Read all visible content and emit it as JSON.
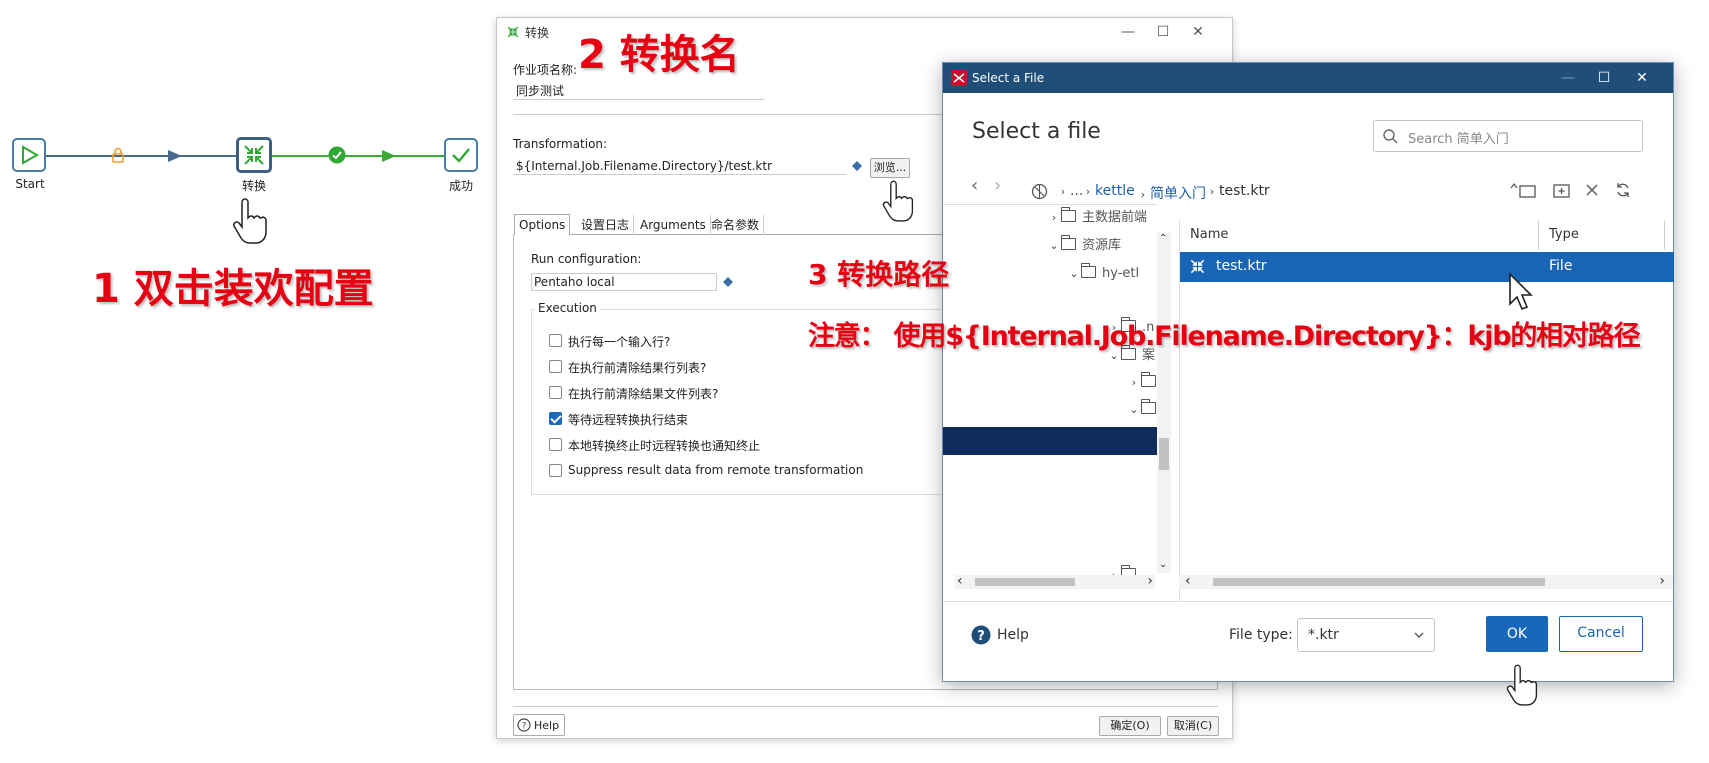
{
  "workflow": {
    "nodes": [
      {
        "label": "Start"
      },
      {
        "label": "转换"
      },
      {
        "label": "成功"
      }
    ]
  },
  "annotations": {
    "step1": "1 双击装欢配置",
    "step2": "2 转换名",
    "step3": "3 转换路径",
    "note": "注意： 使用${Internal.Job.Filename.Directory}：kjb的相对路径"
  },
  "trans_dialog": {
    "title": "转换",
    "job_entry_name_label": "作业项名称:",
    "job_entry_name_value": "同步测试",
    "transformation_label": "Transformation:",
    "transformation_value": "${Internal.Job.Filename.Directory}/test.ktr",
    "browse_label": "浏览...",
    "tabs": [
      "Options",
      "设置日志",
      "Arguments",
      "命名参数"
    ],
    "run_config_label": "Run configuration:",
    "run_config_value": "Pentaho local",
    "execution_label": "Execution",
    "options": [
      {
        "label": "执行每一个输入行?",
        "checked": false
      },
      {
        "label": "在执行前清除结果行列表?",
        "checked": false
      },
      {
        "label": "在执行前清除结果文件列表?",
        "checked": false
      },
      {
        "label": "等待远程转换执行结束",
        "checked": true
      },
      {
        "label": "本地转换终止时远程转换也通知终止",
        "checked": false
      },
      {
        "label": "Suppress result data from remote transformation",
        "checked": false
      }
    ],
    "help_label": "Help",
    "ok_label": "确定(O)",
    "cancel_label": "取消(C)"
  },
  "file_dialog": {
    "title": "Select a File",
    "heading": "Select a file",
    "search_placeholder": "Search 简单入门",
    "breadcrumb": [
      "...",
      "kettle",
      "简单入门",
      "test.ktr"
    ],
    "tree": [
      "主数据前端",
      "资源库",
      "hy-etl",
      ".n",
      "案"
    ],
    "columns": [
      "Name",
      "Type"
    ],
    "rows": [
      {
        "name": "test.ktr",
        "type": "File"
      }
    ],
    "help_label": "Help",
    "file_type_label": "File type:",
    "file_type_value": "*.ktr",
    "ok_label": "OK",
    "cancel_label": "Cancel",
    "colors": {
      "titlebar": "#1f4e79",
      "selection": "#1865b5",
      "tree_selection": "#0f2b5b",
      "primary": "#1867b8"
    }
  }
}
